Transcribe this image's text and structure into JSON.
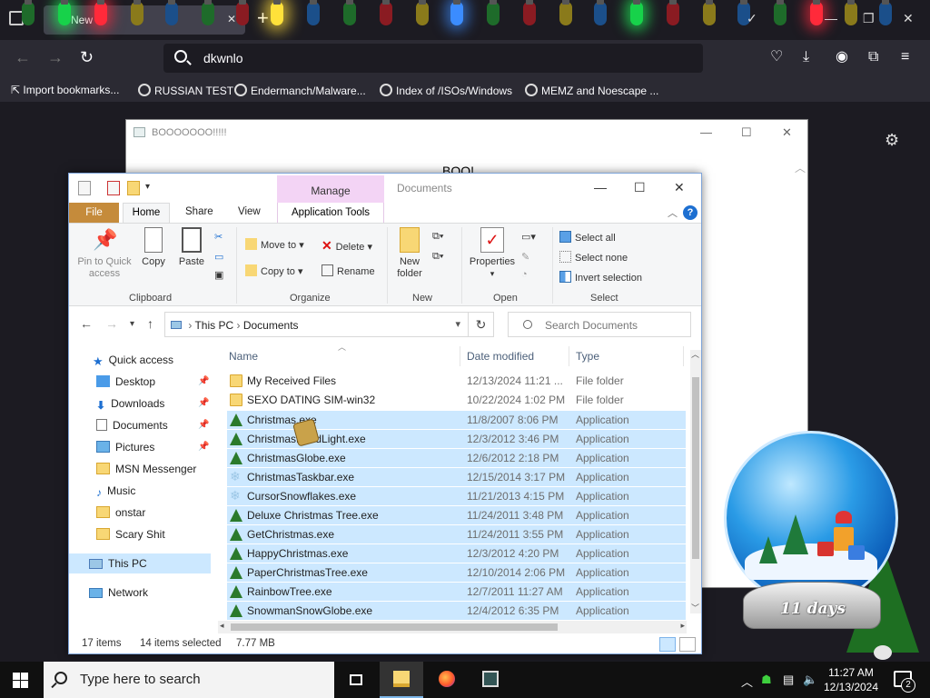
{
  "browser": {
    "tab_title": "New",
    "url_text": "dkwnlo",
    "bookmarks": [
      {
        "label": "Import bookmarks..."
      },
      {
        "label": "RUSSIAN TEST"
      },
      {
        "label": "Endermanch/Malware..."
      },
      {
        "label": "Index of /ISOs/Windows"
      },
      {
        "label": "MEMZ and Noescape ..."
      }
    ]
  },
  "boo_window": {
    "title": "BOOOOOOO!!!!!",
    "body_text": "BOO!"
  },
  "explorer": {
    "manage_label": "Manage",
    "window_title": "Documents",
    "ribbon_tabs": {
      "file": "File",
      "home": "Home",
      "share": "Share",
      "view": "View",
      "app_tools": "Application Tools"
    },
    "ribbon": {
      "pin": "Pin to Quick access",
      "copy": "Copy",
      "paste": "Paste",
      "move_to": "Move to",
      "copy_to": "Copy to",
      "delete": "Delete",
      "rename": "Rename",
      "new_folder": "New folder",
      "properties": "Properties",
      "select_all": "Select all",
      "select_none": "Select none",
      "invert_selection": "Invert selection",
      "groups": {
        "clipboard": "Clipboard",
        "organize": "Organize",
        "new": "New",
        "open": "Open",
        "select": "Select"
      }
    },
    "address": {
      "this_pc": "This PC",
      "documents": "Documents",
      "search_placeholder": "Search Documents"
    },
    "nav": [
      {
        "label": "Quick access"
      },
      {
        "label": "Desktop"
      },
      {
        "label": "Downloads"
      },
      {
        "label": "Documents"
      },
      {
        "label": "Pictures"
      },
      {
        "label": "MSN Messenger"
      },
      {
        "label": "Music"
      },
      {
        "label": "onstar"
      },
      {
        "label": "Scary Shit"
      },
      {
        "label": "This PC"
      },
      {
        "label": "Network"
      }
    ],
    "columns": {
      "name": "Name",
      "date": "Date modified",
      "type": "Type"
    },
    "files": [
      {
        "name": "My Received Files",
        "date": "12/13/2024 11:21 ...",
        "type": "File folder",
        "icon": "folder-icon",
        "selected": false
      },
      {
        "name": "SEXO DATING SIM-win32",
        "date": "10/22/2024 1:02 PM",
        "type": "File folder",
        "icon": "folder-icon",
        "selected": false
      },
      {
        "name": "Christmas.exe",
        "date": "11/8/2007 8:06 PM",
        "type": "Application",
        "icon": "tree-icon",
        "selected": true
      },
      {
        "name": "ChristmasBandLight.exe",
        "date": "12/3/2012 3:46 PM",
        "type": "Application",
        "icon": "tree-icon",
        "selected": true
      },
      {
        "name": "ChristmasGlobe.exe",
        "date": "12/6/2012 2:18 PM",
        "type": "Application",
        "icon": "tree-icon",
        "selected": true
      },
      {
        "name": "ChristmasTaskbar.exe",
        "date": "12/15/2014 3:17 PM",
        "type": "Application",
        "icon": "snowflake-icon",
        "selected": true
      },
      {
        "name": "CursorSnowflakes.exe",
        "date": "11/21/2013 4:15 PM",
        "type": "Application",
        "icon": "snowflake-icon",
        "selected": true
      },
      {
        "name": "Deluxe Christmas Tree.exe",
        "date": "11/24/2011 3:48 PM",
        "type": "Application",
        "icon": "tree-icon",
        "selected": true
      },
      {
        "name": "GetChristmas.exe",
        "date": "11/24/2011 3:55 PM",
        "type": "Application",
        "icon": "tree-icon",
        "selected": true
      },
      {
        "name": "HappyChristmas.exe",
        "date": "12/3/2012 4:20 PM",
        "type": "Application",
        "icon": "tree-icon",
        "selected": true
      },
      {
        "name": "PaperChristmasTree.exe",
        "date": "12/10/2014 2:06 PM",
        "type": "Application",
        "icon": "tree-icon",
        "selected": true
      },
      {
        "name": "RainbowTree.exe",
        "date": "12/7/2011 11:27 AM",
        "type": "Application",
        "icon": "tree-icon",
        "selected": true
      },
      {
        "name": "SnowmanSnowGlobe.exe",
        "date": "12/4/2012 6:35 PM",
        "type": "Application",
        "icon": "tree-icon",
        "selected": true
      }
    ],
    "status": {
      "items": "17 items",
      "selected": "14 items selected",
      "size": "7.77 MB"
    }
  },
  "snow_globe": {
    "label": "11 days"
  },
  "taskbar": {
    "search_placeholder": "Type here to search",
    "time": "11:27 AM",
    "date": "12/13/2024",
    "notification_count": "2"
  }
}
